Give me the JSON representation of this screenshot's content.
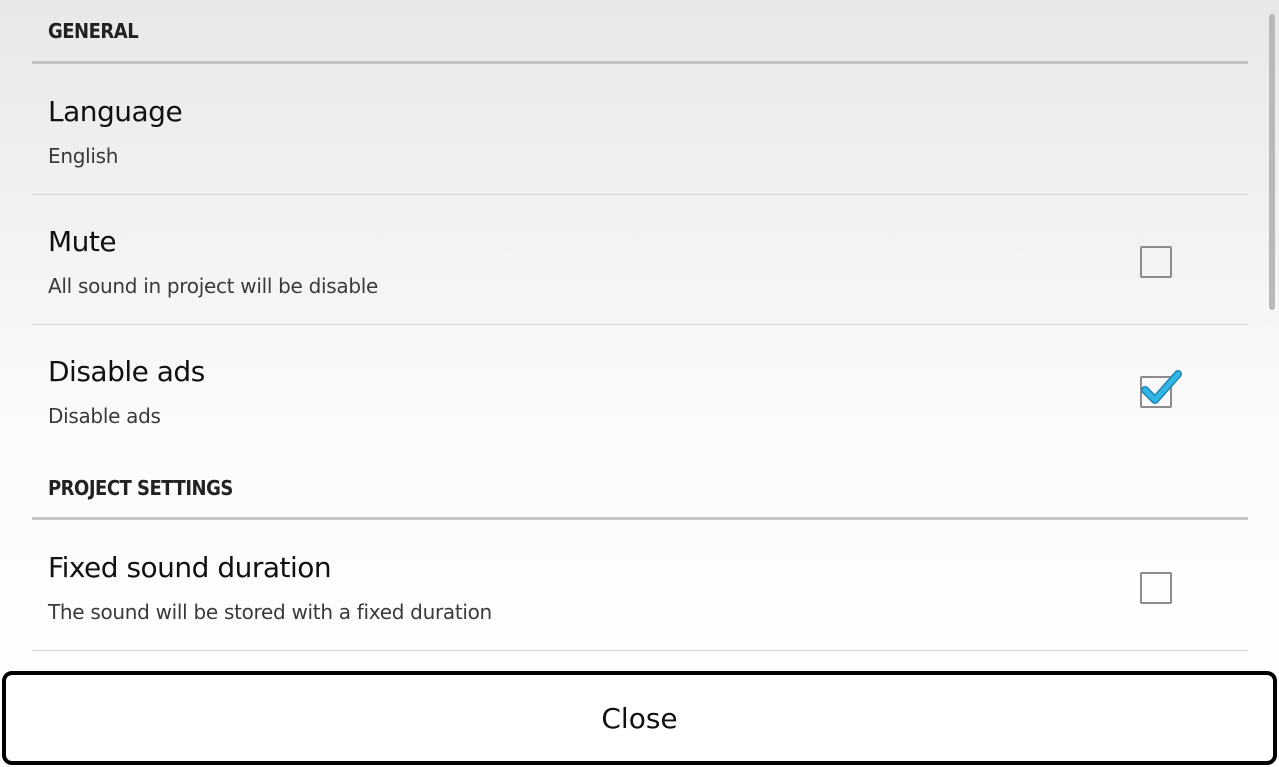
{
  "sections": {
    "general": {
      "title": "GENERAL"
    },
    "project": {
      "title": "PROJECT SETTINGS"
    }
  },
  "prefs": {
    "language": {
      "title": "Language",
      "summary": "English"
    },
    "mute": {
      "title": "Mute",
      "summary": "All sound in project will be disable",
      "checked": false
    },
    "disable_ads": {
      "title": "Disable ads",
      "summary": "Disable ads",
      "checked": true
    },
    "fixed_duration": {
      "title": "Fixed sound duration",
      "summary": "The sound will be stored with a fixed duration",
      "checked": false
    }
  },
  "close_label": "Close",
  "colors": {
    "check_accent": "#33b5e5",
    "divider": "#c4c4c4"
  },
  "icons": {
    "checkmark": "checkmark-icon"
  }
}
